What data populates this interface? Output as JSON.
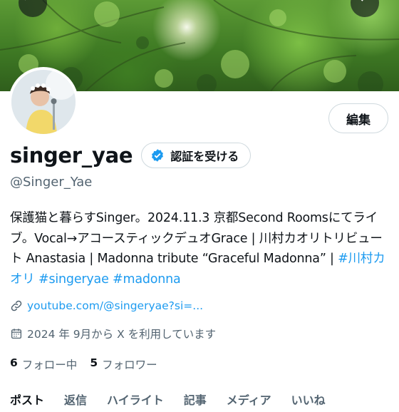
{
  "header": {
    "back_icon": "arrow-left-icon",
    "search_icon": "search-icon"
  },
  "profile": {
    "edit_label": "編集",
    "display_name": "singer_yae",
    "verify_label": "認証を受ける",
    "handle": "@Singer_Yae",
    "bio_text": "保護猫と暮らすSinger。2024.11.3 京都Second Roomsにてライブ。Vocal→アコースティックデュオGrace | 川村カオリトリビュート Anastasia | Madonna tribute “Graceful Madonna” | ",
    "hashtags": [
      "#川村カオリ",
      "#singeryae",
      "#madonna"
    ],
    "link": "youtube.com/@singeryae?si=...",
    "joined": "2024 年 9月から X を利用しています",
    "following_count": "6",
    "following_label": "フォロー中",
    "followers_count": "5",
    "followers_label": "フォロワー"
  },
  "tabs": [
    "ポスト",
    "返信",
    "ハイライト",
    "記事",
    "メディア",
    "いいね"
  ],
  "colors": {
    "accent": "#1d9bf0",
    "secondary_text": "#536471",
    "primary_text": "#0f1419"
  }
}
